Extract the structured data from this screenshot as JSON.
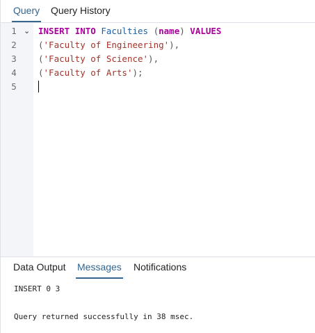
{
  "top_tabs": {
    "query": "Query",
    "history": "Query History"
  },
  "editor": {
    "line_numbers": [
      "1",
      "2",
      "3",
      "4",
      "5"
    ],
    "line1": {
      "kw_insert": "INSERT",
      "kw_into": "INTO",
      "table": "Faculties",
      "open_paren": "(",
      "column": "name",
      "close_paren": ")",
      "kw_values": "VALUES"
    },
    "line2": {
      "open": "(",
      "value": "'Faculty of Engineering'",
      "close": "),"
    },
    "line3": {
      "open": "(",
      "value": "'Faculty of Science'",
      "close": "),"
    },
    "line4": {
      "open": "(",
      "value": "'Faculty of Arts'",
      "close": ");"
    }
  },
  "bottom_tabs": {
    "data_output": "Data Output",
    "messages": "Messages",
    "notifications": "Notifications"
  },
  "messages": {
    "result": "INSERT 0 3",
    "status": "Query returned successfully in 38 msec."
  },
  "colors": {
    "accent": "#326690",
    "keyword": "#a8009b",
    "identifier": "#1b5fa3",
    "string": "#a4322a",
    "gutter_bg": "#f3f5f9"
  }
}
